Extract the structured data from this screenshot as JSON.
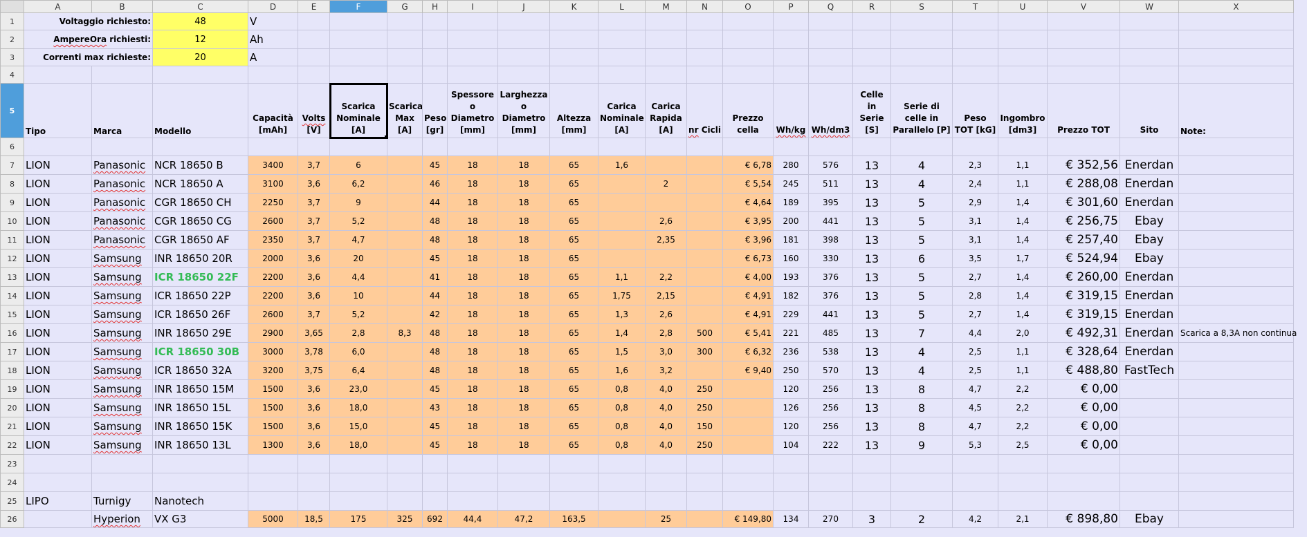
{
  "columns": [
    "A",
    "B",
    "C",
    "D",
    "E",
    "F",
    "G",
    "H",
    "I",
    "J",
    "K",
    "L",
    "M",
    "N",
    "O",
    "P",
    "Q",
    "R",
    "S",
    "T",
    "U",
    "V",
    "W",
    "X"
  ],
  "selected_column": "F",
  "params": [
    {
      "row": "1",
      "label": "Voltaggio richiesto:",
      "value": "48",
      "unit": "V"
    },
    {
      "row": "2",
      "label": "AmpereOra richiesti:",
      "value": "12",
      "unit": "Ah"
    },
    {
      "row": "3",
      "label": "Correnti max richieste:",
      "value": "20",
      "unit": "A"
    }
  ],
  "headers": [
    "Tipo",
    "Marca",
    "Modello",
    "Capacità [mAh]",
    "Volts [V]",
    "Scarica Nominale [A]",
    "Scarica Max [A]",
    "Peso [gr]",
    "Spessore o Diametro [mm]",
    "Larghezza o Diametro [mm]",
    "Altezza [mm]",
    "Carica Nominale [A]",
    "Carica Rapida [A]",
    "nr Cicli",
    "Prezzo cella",
    "Wh/kg",
    "Wh/dm3",
    "Celle in Serie [S]",
    "Serie di celle in Parallelo [P]",
    "Peso TOT [kG]",
    "Ingombro [dm3]",
    "Prezzo TOT",
    "Sito",
    "Note:"
  ],
  "rows": [
    {
      "n": "7",
      "tipo": "LION",
      "marca": "Panasonic",
      "modello": "NCR 18650 B",
      "cap": "3400",
      "volts": "3,7",
      "snom": "6",
      "smax": "",
      "peso": "45",
      "spess": "18",
      "larg": "18",
      "alt": "65",
      "cnom": "1,6",
      "crap": "",
      "cicli": "",
      "prezzo": "€ 6,78",
      "whkg": "280",
      "whdm3": "576",
      "serie": "13",
      "par": "4",
      "pesotot": "2,3",
      "ingombro": "1,1",
      "prezzotot": "€ 352,56",
      "sito": "Enerdan",
      "note": ""
    },
    {
      "n": "8",
      "tipo": "LION",
      "marca": "Panasonic",
      "modello": "NCR 18650 A",
      "cap": "3100",
      "volts": "3,6",
      "snom": "6,2",
      "smax": "",
      "peso": "46",
      "spess": "18",
      "larg": "18",
      "alt": "65",
      "cnom": "",
      "crap": "2",
      "cicli": "",
      "prezzo": "€ 5,54",
      "whkg": "245",
      "whdm3": "511",
      "serie": "13",
      "par": "4",
      "pesotot": "2,4",
      "ingombro": "1,1",
      "prezzotot": "€ 288,08",
      "sito": "Enerdan",
      "note": ""
    },
    {
      "n": "9",
      "tipo": "LION",
      "marca": "Panasonic",
      "modello": "CGR 18650 CH",
      "cap": "2250",
      "volts": "3,7",
      "snom": "9",
      "smax": "",
      "peso": "44",
      "spess": "18",
      "larg": "18",
      "alt": "65",
      "cnom": "",
      "crap": "",
      "cicli": "",
      "prezzo": "€ 4,64",
      "whkg": "189",
      "whdm3": "395",
      "serie": "13",
      "par": "5",
      "pesotot": "2,9",
      "ingombro": "1,4",
      "prezzotot": "€ 301,60",
      "sito": "Enerdan",
      "note": ""
    },
    {
      "n": "10",
      "tipo": "LION",
      "marca": "Panasonic",
      "modello": "CGR 18650 CG",
      "cap": "2600",
      "volts": "3,7",
      "snom": "5,2",
      "smax": "",
      "peso": "48",
      "spess": "18",
      "larg": "18",
      "alt": "65",
      "cnom": "",
      "crap": "2,6",
      "cicli": "",
      "prezzo": "€ 3,95",
      "whkg": "200",
      "whdm3": "441",
      "serie": "13",
      "par": "5",
      "pesotot": "3,1",
      "ingombro": "1,4",
      "prezzotot": "€ 256,75",
      "sito": "Ebay",
      "note": ""
    },
    {
      "n": "11",
      "tipo": "LION",
      "marca": "Panasonic",
      "modello": "CGR 18650 AF",
      "cap": "2350",
      "volts": "3,7",
      "snom": "4,7",
      "smax": "",
      "peso": "48",
      "spess": "18",
      "larg": "18",
      "alt": "65",
      "cnom": "",
      "crap": "2,35",
      "cicli": "",
      "prezzo": "€ 3,96",
      "whkg": "181",
      "whdm3": "398",
      "serie": "13",
      "par": "5",
      "pesotot": "3,1",
      "ingombro": "1,4",
      "prezzotot": "€ 257,40",
      "sito": "Ebay",
      "note": ""
    },
    {
      "n": "12",
      "tipo": "LION",
      "marca": "Samsung",
      "modello": "INR 18650 20R",
      "cap": "2000",
      "volts": "3,6",
      "snom": "20",
      "smax": "",
      "peso": "45",
      "spess": "18",
      "larg": "18",
      "alt": "65",
      "cnom": "",
      "crap": "",
      "cicli": "",
      "prezzo": "€ 6,73",
      "whkg": "160",
      "whdm3": "330",
      "serie": "13",
      "par": "6",
      "pesotot": "3,5",
      "ingombro": "1,7",
      "prezzotot": "€ 524,94",
      "sito": "Ebay",
      "note": ""
    },
    {
      "n": "13",
      "tipo": "LION",
      "marca": "Samsung",
      "modello": "ICR  18650 22F",
      "cap": "2200",
      "volts": "3,6",
      "snom": "4,4",
      "smax": "",
      "peso": "41",
      "spess": "18",
      "larg": "18",
      "alt": "65",
      "cnom": "1,1",
      "crap": "2,2",
      "cicli": "",
      "prezzo": "€ 4,00",
      "whkg": "193",
      "whdm3": "376",
      "serie": "13",
      "par": "5",
      "pesotot": "2,7",
      "ingombro": "1,4",
      "prezzotot": "€ 260,00",
      "sito": "Enerdan",
      "note": ""
    },
    {
      "n": "14",
      "tipo": "LION",
      "marca": "Samsung",
      "modello": "ICR  18650 22P",
      "cap": "2200",
      "volts": "3,6",
      "snom": "10",
      "smax": "",
      "peso": "44",
      "spess": "18",
      "larg": "18",
      "alt": "65",
      "cnom": "1,75",
      "crap": "2,15",
      "cicli": "",
      "prezzo": "€ 4,91",
      "whkg": "182",
      "whdm3": "376",
      "serie": "13",
      "par": "5",
      "pesotot": "2,8",
      "ingombro": "1,4",
      "prezzotot": "€ 319,15",
      "sito": "Enerdan",
      "note": ""
    },
    {
      "n": "15",
      "tipo": "LION",
      "marca": "Samsung",
      "modello": "ICR  18650 26F",
      "cap": "2600",
      "volts": "3,7",
      "snom": "5,2",
      "smax": "",
      "peso": "42",
      "spess": "18",
      "larg": "18",
      "alt": "65",
      "cnom": "1,3",
      "crap": "2,6",
      "cicli": "",
      "prezzo": "€ 4,91",
      "whkg": "229",
      "whdm3": "441",
      "serie": "13",
      "par": "5",
      "pesotot": "2,7",
      "ingombro": "1,4",
      "prezzotot": "€ 319,15",
      "sito": "Enerdan",
      "note": ""
    },
    {
      "n": "16",
      "tipo": "LION",
      "marca": "Samsung",
      "modello": "INR  18650 29E",
      "cap": "2900",
      "volts": "3,65",
      "snom": "2,8",
      "smax": "8,3",
      "peso": "48",
      "spess": "18",
      "larg": "18",
      "alt": "65",
      "cnom": "1,4",
      "crap": "2,8",
      "cicli": "500",
      "prezzo": "€ 5,41",
      "whkg": "221",
      "whdm3": "485",
      "serie": "13",
      "par": "7",
      "pesotot": "4,4",
      "ingombro": "2,0",
      "prezzotot": "€ 492,31",
      "sito": "Enerdan",
      "note": "Scarica a 8,3A non continua"
    },
    {
      "n": "17",
      "tipo": "LION",
      "marca": "Samsung",
      "modello": "ICR  18650 30B",
      "cap": "3000",
      "volts": "3,78",
      "snom": "6,0",
      "smax": "",
      "peso": "48",
      "spess": "18",
      "larg": "18",
      "alt": "65",
      "cnom": "1,5",
      "crap": "3,0",
      "cicli": "300",
      "prezzo": "€ 6,32",
      "whkg": "236",
      "whdm3": "538",
      "serie": "13",
      "par": "4",
      "pesotot": "2,5",
      "ingombro": "1,1",
      "prezzotot": "€ 328,64",
      "sito": "Enerdan",
      "note": ""
    },
    {
      "n": "18",
      "tipo": "LION",
      "marca": "Samsung",
      "modello": "ICR  18650 32A",
      "cap": "3200",
      "volts": "3,75",
      "snom": "6,4",
      "smax": "",
      "peso": "48",
      "spess": "18",
      "larg": "18",
      "alt": "65",
      "cnom": "1,6",
      "crap": "3,2",
      "cicli": "",
      "prezzo": "€ 9,40",
      "whkg": "250",
      "whdm3": "570",
      "serie": "13",
      "par": "4",
      "pesotot": "2,5",
      "ingombro": "1,1",
      "prezzotot": "€ 488,80",
      "sito": "FastTech",
      "note": ""
    },
    {
      "n": "19",
      "tipo": "LION",
      "marca": "Samsung",
      "modello": "INR  18650 15M",
      "cap": "1500",
      "volts": "3,6",
      "snom": "23,0",
      "smax": "",
      "peso": "45",
      "spess": "18",
      "larg": "18",
      "alt": "65",
      "cnom": "0,8",
      "crap": "4,0",
      "cicli": "250",
      "prezzo": "",
      "whkg": "120",
      "whdm3": "256",
      "serie": "13",
      "par": "8",
      "pesotot": "4,7",
      "ingombro": "2,2",
      "prezzotot": "€ 0,00",
      "sito": "",
      "note": ""
    },
    {
      "n": "20",
      "tipo": "LION",
      "marca": "Samsung",
      "modello": "INR  18650 15L",
      "cap": "1500",
      "volts": "3,6",
      "snom": "18,0",
      "smax": "",
      "peso": "43",
      "spess": "18",
      "larg": "18",
      "alt": "65",
      "cnom": "0,8",
      "crap": "4,0",
      "cicli": "250",
      "prezzo": "",
      "whkg": "126",
      "whdm3": "256",
      "serie": "13",
      "par": "8",
      "pesotot": "4,5",
      "ingombro": "2,2",
      "prezzotot": "€ 0,00",
      "sito": "",
      "note": ""
    },
    {
      "n": "21",
      "tipo": "LION",
      "marca": "Samsung",
      "modello": "INR  18650 15K",
      "cap": "1500",
      "volts": "3,6",
      "snom": "15,0",
      "smax": "",
      "peso": "45",
      "spess": "18",
      "larg": "18",
      "alt": "65",
      "cnom": "0,8",
      "crap": "4,0",
      "cicli": "150",
      "prezzo": "",
      "whkg": "120",
      "whdm3": "256",
      "serie": "13",
      "par": "8",
      "pesotot": "4,7",
      "ingombro": "2,2",
      "prezzotot": "€ 0,00",
      "sito": "",
      "note": ""
    },
    {
      "n": "22",
      "tipo": "LION",
      "marca": "Samsung",
      "modello": "INR  18650 13L",
      "cap": "1300",
      "volts": "3,6",
      "snom": "18,0",
      "smax": "",
      "peso": "45",
      "spess": "18",
      "larg": "18",
      "alt": "65",
      "cnom": "0,8",
      "crap": "4,0",
      "cicli": "250",
      "prezzo": "",
      "whkg": "104",
      "whdm3": "222",
      "serie": "13",
      "par": "9",
      "pesotot": "5,3",
      "ingombro": "2,5",
      "prezzotot": "€ 0,00",
      "sito": "",
      "note": ""
    }
  ],
  "row25": {
    "n": "25",
    "tipo": "LIPO",
    "marca": "Turnigy",
    "modello": "Nanotech"
  },
  "row26": {
    "n": "26",
    "tipo": "",
    "marca": "Hyperion",
    "modello": "VX G3",
    "cap": "5000",
    "volts": "18,5",
    "snom": "175",
    "smax": "325",
    "peso": "692",
    "spess": "44,4",
    "larg": "47,2",
    "alt": "163,5",
    "cnom": "",
    "crap": "25",
    "cicli": "",
    "prezzo": "€ 149,80",
    "whkg": "134",
    "whdm3": "270",
    "serie": "3",
    "par": "2",
    "pesotot": "4,2",
    "ingombro": "2,1",
    "prezzotot": "€ 898,80",
    "sito": "Ebay",
    "note": ""
  },
  "green_models": [
    "13",
    "17"
  ],
  "empty_rows": [
    "4",
    "6",
    "23",
    "24"
  ],
  "colors": {
    "param_fill": "#ffff66",
    "data_fill": "#ffcc99",
    "grid_bg": "#e6e6fa",
    "selection": "#4f9edb",
    "green_text": "#33bb55"
  }
}
